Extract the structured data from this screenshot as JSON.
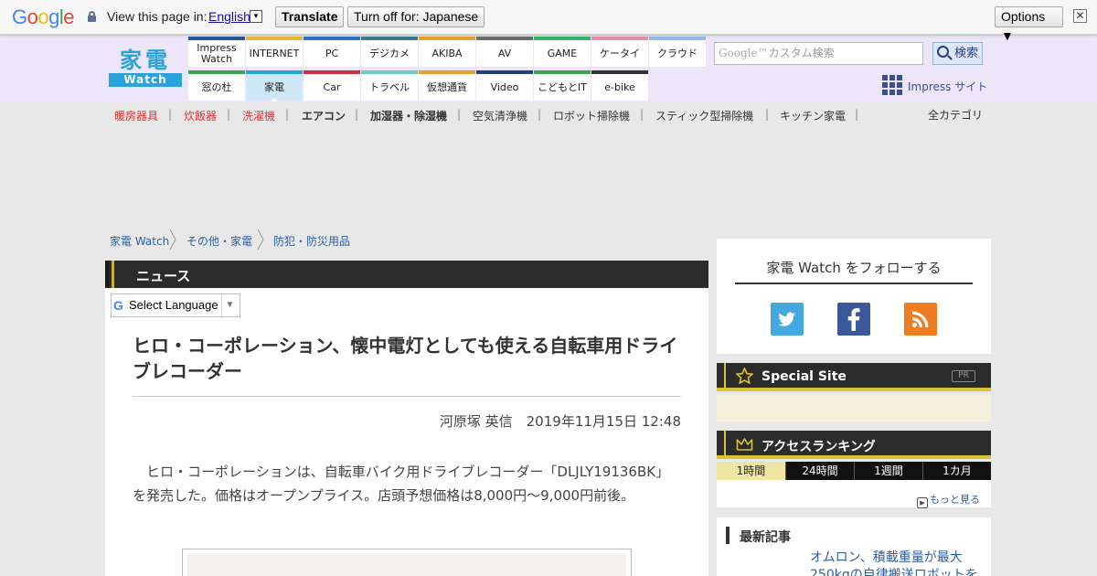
{
  "translate_bar": {
    "logo": "Google",
    "view_text": "View this page in:",
    "language": "English",
    "language_dropdown": "▾",
    "translate_label": "Translate",
    "turn_off_label": "Turn off for: Japanese",
    "options_label": "Options ▼",
    "close_label": "✕"
  },
  "header": {
    "logo_kanji": "家電",
    "logo_word": "Watch",
    "nav_top": [
      {
        "label": "Impress\nWatch",
        "color": "#2a56a0"
      },
      {
        "label": "INTERNET",
        "color": "#e8b935"
      },
      {
        "label": "PC",
        "color": "#2c74c8"
      },
      {
        "label": "デジカメ",
        "color": "#3a7a8c"
      },
      {
        "label": "AKIBA",
        "color": "#e8a12e"
      },
      {
        "label": "AV",
        "color": "#6d6d6d"
      },
      {
        "label": "GAME",
        "color": "#33b36b"
      },
      {
        "label": "ケータイ",
        "color": "#e890a8"
      },
      {
        "label": "クラウド",
        "color": "#8fbce8"
      }
    ],
    "nav_bottom": [
      {
        "label": "窓の杜",
        "color": "#3aa650"
      },
      {
        "label": "家電",
        "color": "#2aa2da",
        "active": true
      },
      {
        "label": "Car",
        "color": "#d0303c"
      },
      {
        "label": "トラベル",
        "color": "#6ecfc0"
      },
      {
        "label": "仮想通貨",
        "color": "#e8a12e"
      },
      {
        "label": "Video",
        "color": "#26407a"
      },
      {
        "label": "こどもとIT",
        "color": "#3aa650"
      },
      {
        "label": "e-bike",
        "color": "#333333"
      }
    ],
    "search_brand": "Google™",
    "search_placeholder": "カスタム検索",
    "search_button": "検索",
    "impress_site": "Impress サイト"
  },
  "categories": [
    {
      "label": "暖房器具",
      "style": "red"
    },
    {
      "label": "炊飯器",
      "style": "red"
    },
    {
      "label": "洗濯機",
      "style": "red"
    },
    {
      "label": "エアコン",
      "style": "bold"
    },
    {
      "label": "加湿器・除湿機",
      "style": "bold"
    },
    {
      "label": "空気清浄機",
      "style": "normal"
    },
    {
      "label": "ロボット掃除機",
      "style": "normal"
    },
    {
      "label": "スティック型掃除機",
      "style": "normal"
    },
    {
      "label": "キッチン家電",
      "style": "normal"
    }
  ],
  "category_separator": "|",
  "all_categories": "全カテゴリ",
  "breadcrumb": [
    "家電 Watch",
    "その他・家電",
    "防犯・防災用品"
  ],
  "article": {
    "section": "ニュース",
    "select_language": "Select Language",
    "select_language_dropdown": "▼",
    "headline": "ヒロ・コーポレーション、懐中電灯としても使える自転車用ドライブレコーダー",
    "byline": "河原塚 英信　2019年11月15日 12:48",
    "lead": "　ヒロ・コーポレーションは、自転車バイク用ドライブレコーダー「DLJLY19136BK」を発売した。価格はオープンプライス。店頭予想価格は8,000円～9,000円前後。"
  },
  "sidebar": {
    "follow_title": "家電 Watch をフォローする",
    "special_site": "Special Site",
    "pr_badge": "PR",
    "ranking_title": "アクセスランキング",
    "ranking_tabs": [
      "1時間",
      "24時間",
      "1週間",
      "1カ月"
    ],
    "more": "もっと見る",
    "latest_title": "最新記事",
    "latest_item": "オムロン、積載重量が最大250kgの自律搬送ロボットを"
  },
  "colors": {
    "brand_blue": "#2aa2da",
    "link_blue": "#2b5fa6",
    "accent_red": "#e8322f",
    "header_bg": "#ece6f8",
    "gold": "#d8c533"
  }
}
